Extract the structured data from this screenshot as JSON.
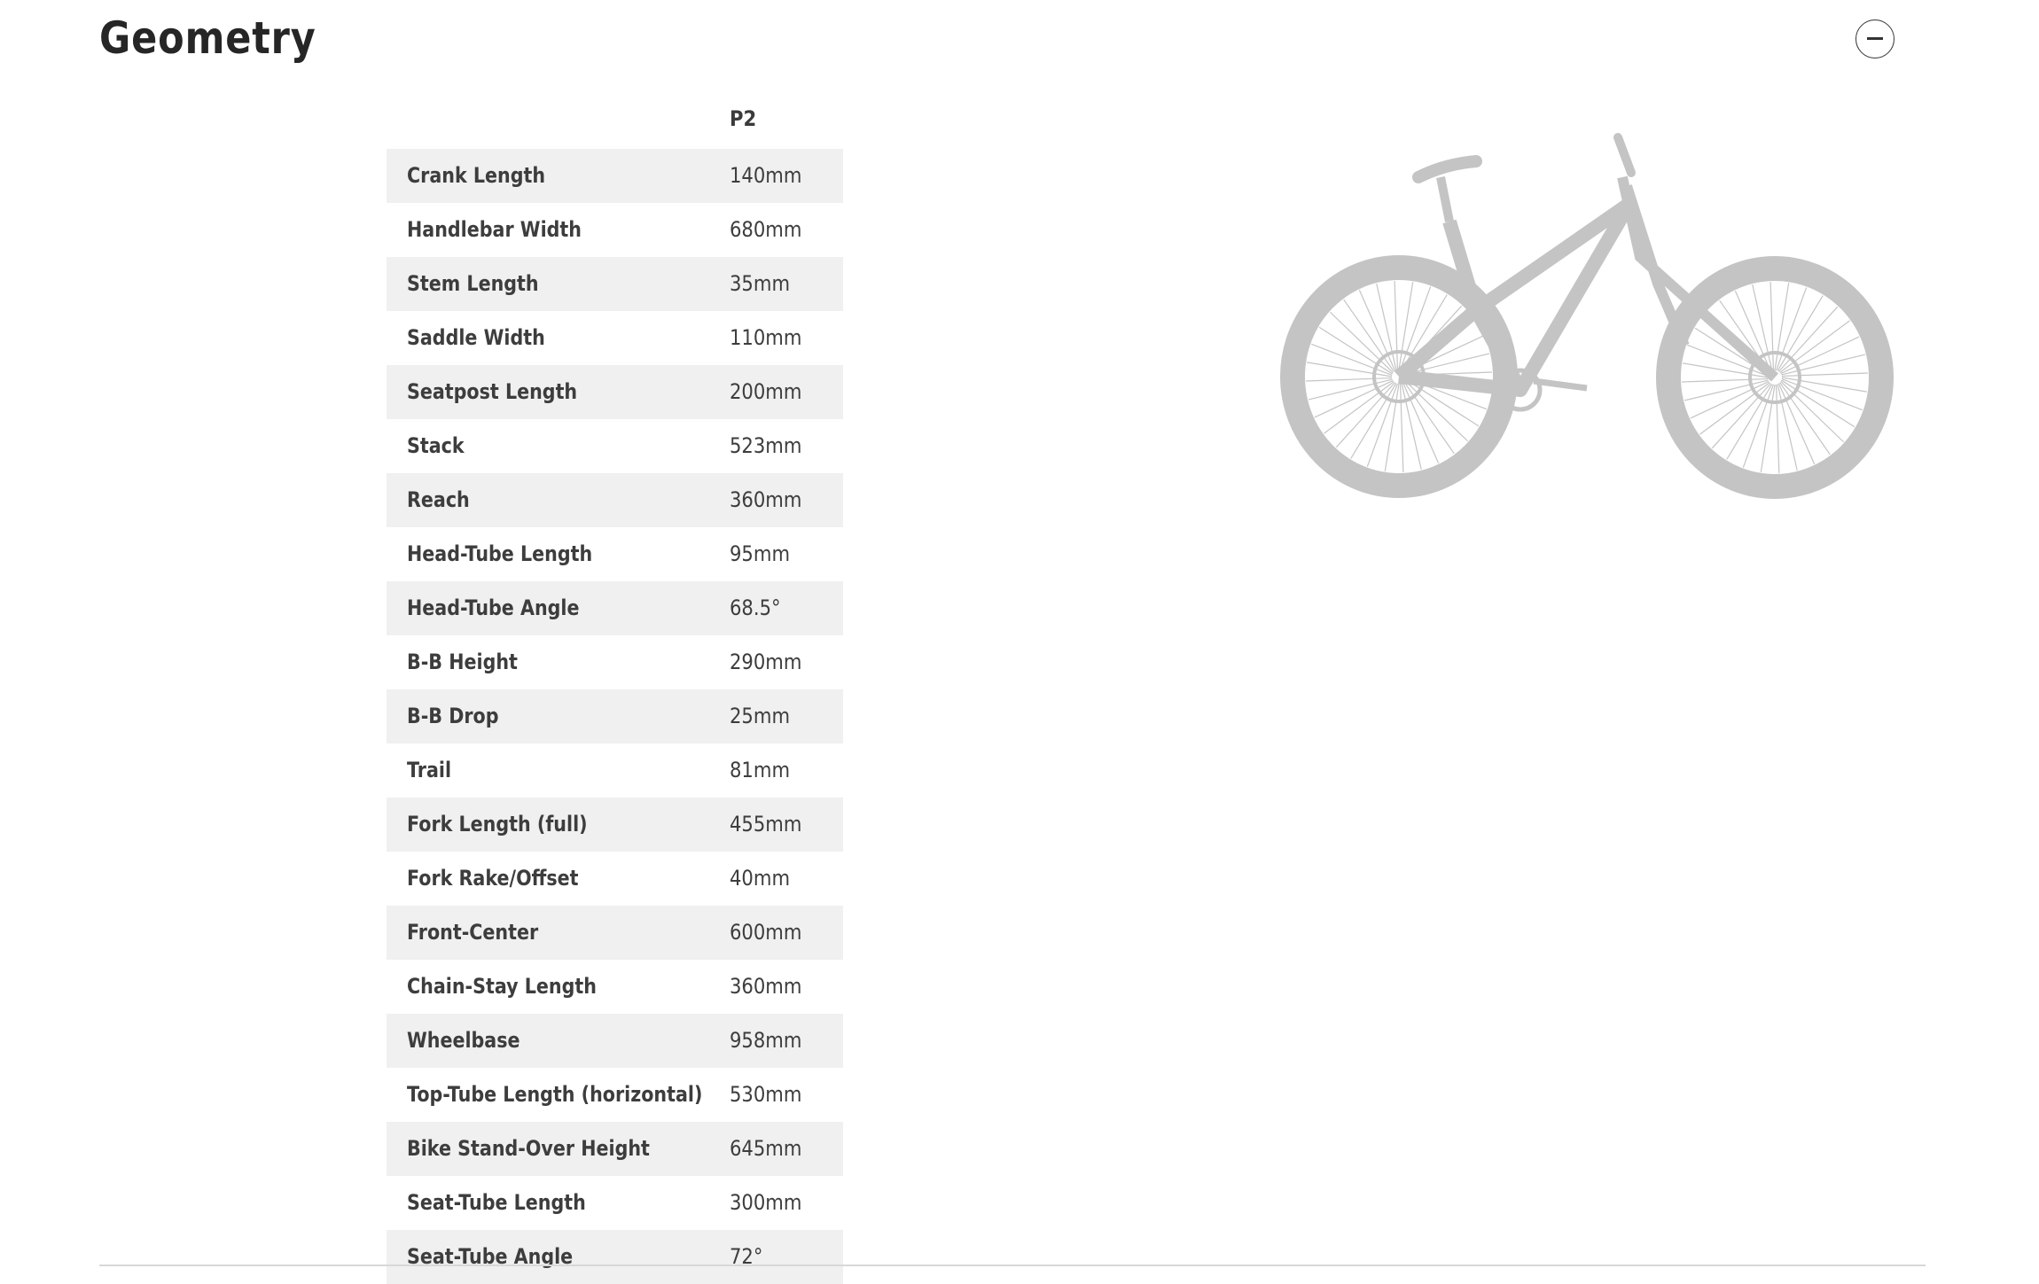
{
  "section": {
    "title": "Geometry",
    "collapse_icon": "minus-circle-icon"
  },
  "table": {
    "columns": [
      "",
      "P2"
    ],
    "rows": [
      {
        "label": "Crank Length",
        "value": "140mm"
      },
      {
        "label": "Handlebar Width",
        "value": "680mm"
      },
      {
        "label": "Stem Length",
        "value": "35mm"
      },
      {
        "label": "Saddle Width",
        "value": "110mm"
      },
      {
        "label": "Seatpost Length",
        "value": "200mm"
      },
      {
        "label": "Stack",
        "value": "523mm"
      },
      {
        "label": "Reach",
        "value": "360mm"
      },
      {
        "label": "Head-Tube Length",
        "value": "95mm"
      },
      {
        "label": "Head-Tube Angle",
        "value": "68.5°"
      },
      {
        "label": "B-B Height",
        "value": "290mm"
      },
      {
        "label": "B-B Drop",
        "value": "25mm"
      },
      {
        "label": "Trail",
        "value": "81mm"
      },
      {
        "label": "Fork Length (full)",
        "value": "455mm"
      },
      {
        "label": "Fork Rake/Offset",
        "value": "40mm"
      },
      {
        "label": "Front-Center",
        "value": "600mm"
      },
      {
        "label": "Chain-Stay Length",
        "value": "360mm"
      },
      {
        "label": "Wheelbase",
        "value": "958mm"
      },
      {
        "label": "Top-Tube Length (horizontal)",
        "value": "530mm"
      },
      {
        "label": "Bike Stand-Over Height",
        "value": "645mm"
      },
      {
        "label": "Seat-Tube Length",
        "value": "300mm"
      },
      {
        "label": "Seat-Tube Angle",
        "value": "72°"
      }
    ]
  },
  "image": {
    "subject": "bike-silhouette",
    "color": "#c4c4c4"
  }
}
